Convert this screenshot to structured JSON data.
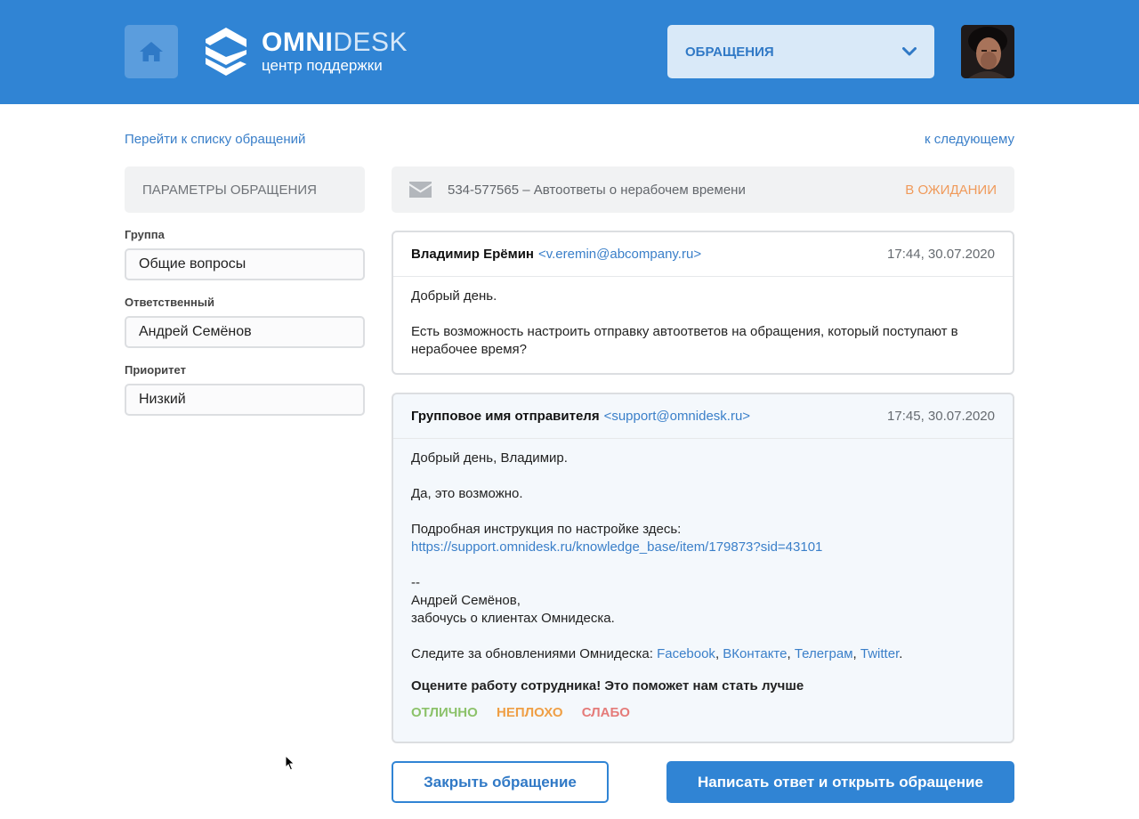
{
  "header": {
    "logo_name_bold": "OMNI",
    "logo_name_light": "DESK",
    "logo_subtitle": "центр поддержки",
    "section_select": "ОБРАЩЕНИЯ",
    "icons": {
      "home": "home-icon",
      "chevron": "chevron-down-icon"
    },
    "accent_color": "#3084d4"
  },
  "nav": {
    "back": "Перейти к списку обращений",
    "next": "к следующему"
  },
  "sidebar": {
    "title": "ПАРАМЕТРЫ ОБРАЩЕНИЯ",
    "fields": [
      {
        "label": "Группа",
        "value": "Общие вопросы"
      },
      {
        "label": "Ответственный",
        "value": "Андрей Семёнов"
      },
      {
        "label": "Приоритет",
        "value": "Низкий"
      }
    ]
  },
  "ticket": {
    "subject": "534-577565 – Автоответы о нерабочем времени",
    "status": "В ОЖИДАНИИ",
    "status_color": "#f09a5a",
    "icon": "envelope-icon"
  },
  "messages": [
    {
      "sender": "Владимир Ерёмин",
      "email": "<v.eremin@abcompany.ru>",
      "time": "17:44, 30.07.2020",
      "greeting": "Добрый день.",
      "text": "Есть возможность настроить отправку автоответов на обращения, который поступают в нерабочее время?"
    },
    {
      "sender": "Групповое имя отправителя",
      "email": "<support@omnidesk.ru>",
      "time": "17:45, 30.07.2020",
      "greeting": "Добрый день, Владимир.",
      "line2": "Да, это возможно.",
      "instruction": "Подробная инструкция по настройке здесь:",
      "instruction_link": "https://support.omnidesk.ru/knowledge_base/item/179873?sid=43101",
      "sig_dash": "--",
      "sig_name": "Андрей Семёнов,",
      "sig_role": "забочусь о клиентах Омнидеска.",
      "follow_text": "Следите за обновлениями Омнидеска: ",
      "social": [
        "Facebook",
        "ВКонтакте",
        "Телеграм",
        "Twitter"
      ],
      "rate_title": "Оцените работу сотрудника! Это поможет нам стать лучше",
      "ratings": [
        {
          "label": "ОТЛИЧНО",
          "color": "#8cc26a"
        },
        {
          "label": "НЕПЛОХО",
          "color": "#ef9f45"
        },
        {
          "label": "СЛАБО",
          "color": "#e57b79"
        }
      ]
    }
  ],
  "actions": {
    "close": "Закрыть обращение",
    "reply": "Написать ответ и открыть обращение"
  }
}
